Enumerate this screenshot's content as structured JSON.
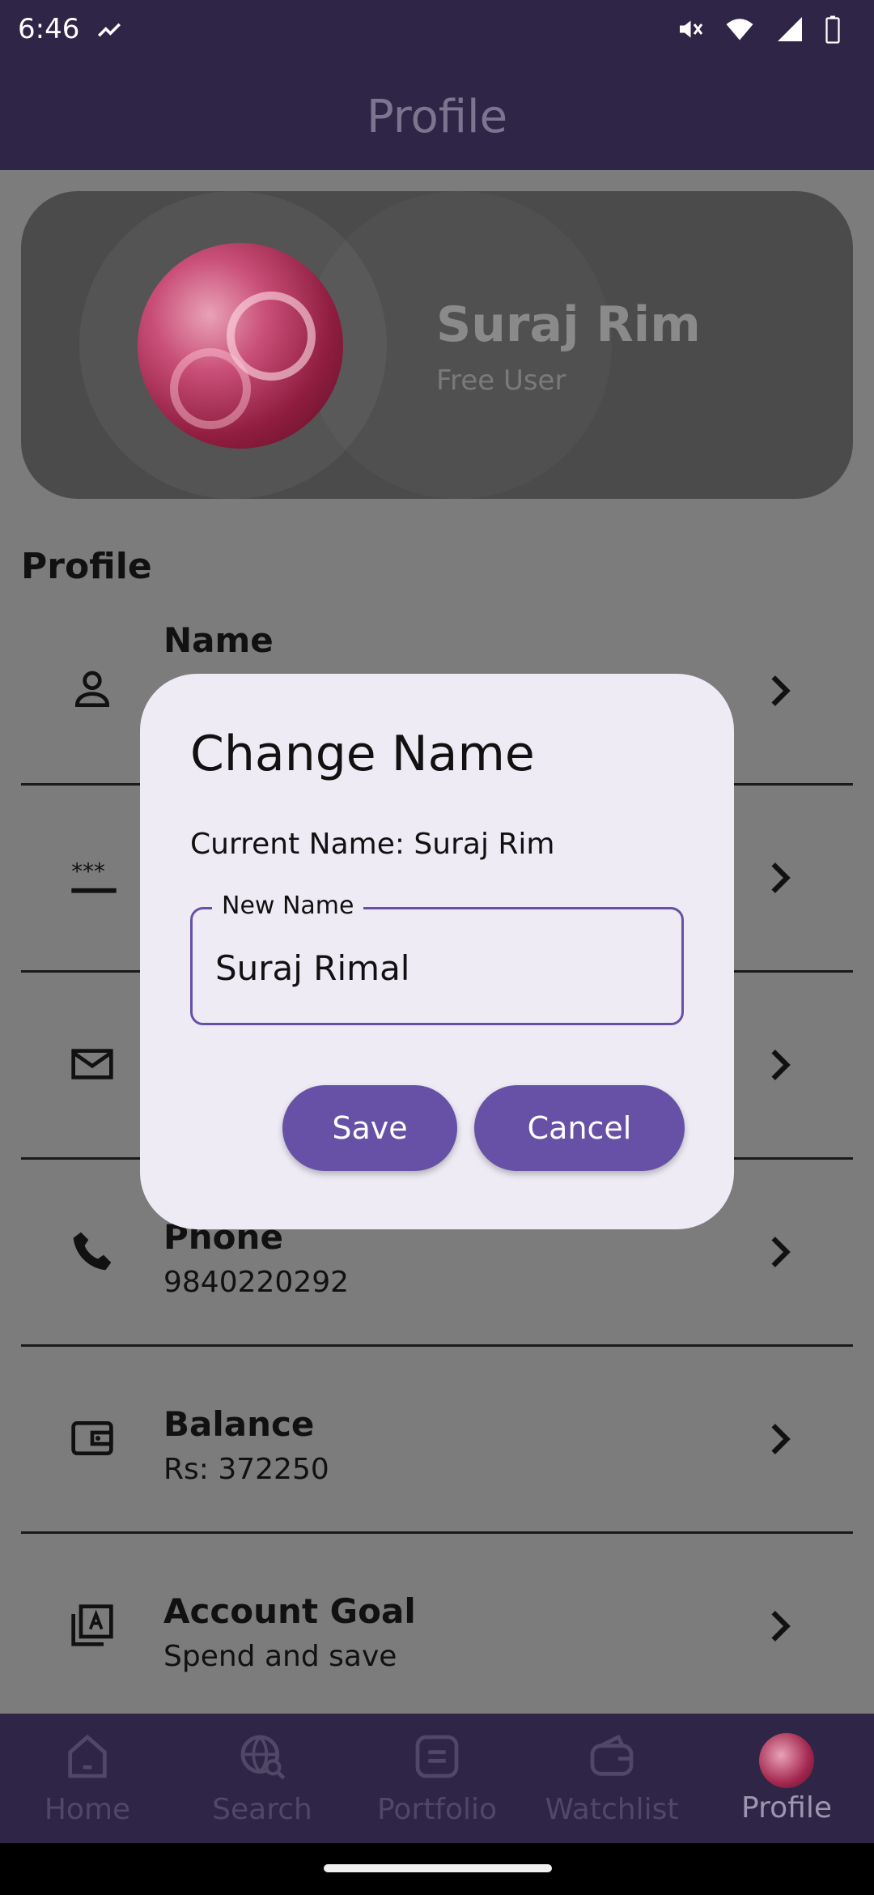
{
  "status_bar": {
    "time": "6:46"
  },
  "app_bar": {
    "title": "Profile"
  },
  "profile_card": {
    "name": "Suraj Rim",
    "subtitle": "Free User"
  },
  "section": {
    "title": "Profile"
  },
  "rows": [
    {
      "title": "Name",
      "value": "",
      "icon": "person-icon"
    },
    {
      "title": "",
      "value": "",
      "icon": "password-icon"
    },
    {
      "title": "",
      "value": "",
      "icon": "mail-icon"
    },
    {
      "title": "Phone",
      "value": "9840220292",
      "icon": "phone-icon"
    },
    {
      "title": "Balance",
      "value": "Rs: 372250",
      "icon": "wallet-icon"
    },
    {
      "title": "Account Goal",
      "value": "Spend and save",
      "icon": "goal-icon"
    }
  ],
  "nav": {
    "items": [
      {
        "label": "Home",
        "icon": "home-icon"
      },
      {
        "label": "Search",
        "icon": "globe-search-icon"
      },
      {
        "label": "Portfolio",
        "icon": "portfolio-icon"
      },
      {
        "label": "Watchlist",
        "icon": "wallet-icon"
      },
      {
        "label": "Profile",
        "icon": "avatar"
      }
    ],
    "active": "Profile"
  },
  "dialog": {
    "title": "Change Name",
    "current_name": "Current Name: Suraj Rim",
    "field_label": "New Name",
    "field_value": "Suraj Rimal",
    "save_label": "Save",
    "cancel_label": "Cancel"
  },
  "colors": {
    "primary": "#6751a6",
    "app_bar": "#2f2547",
    "dialog_bg": "#eeebf5",
    "scrim": "#7c7c7c"
  }
}
